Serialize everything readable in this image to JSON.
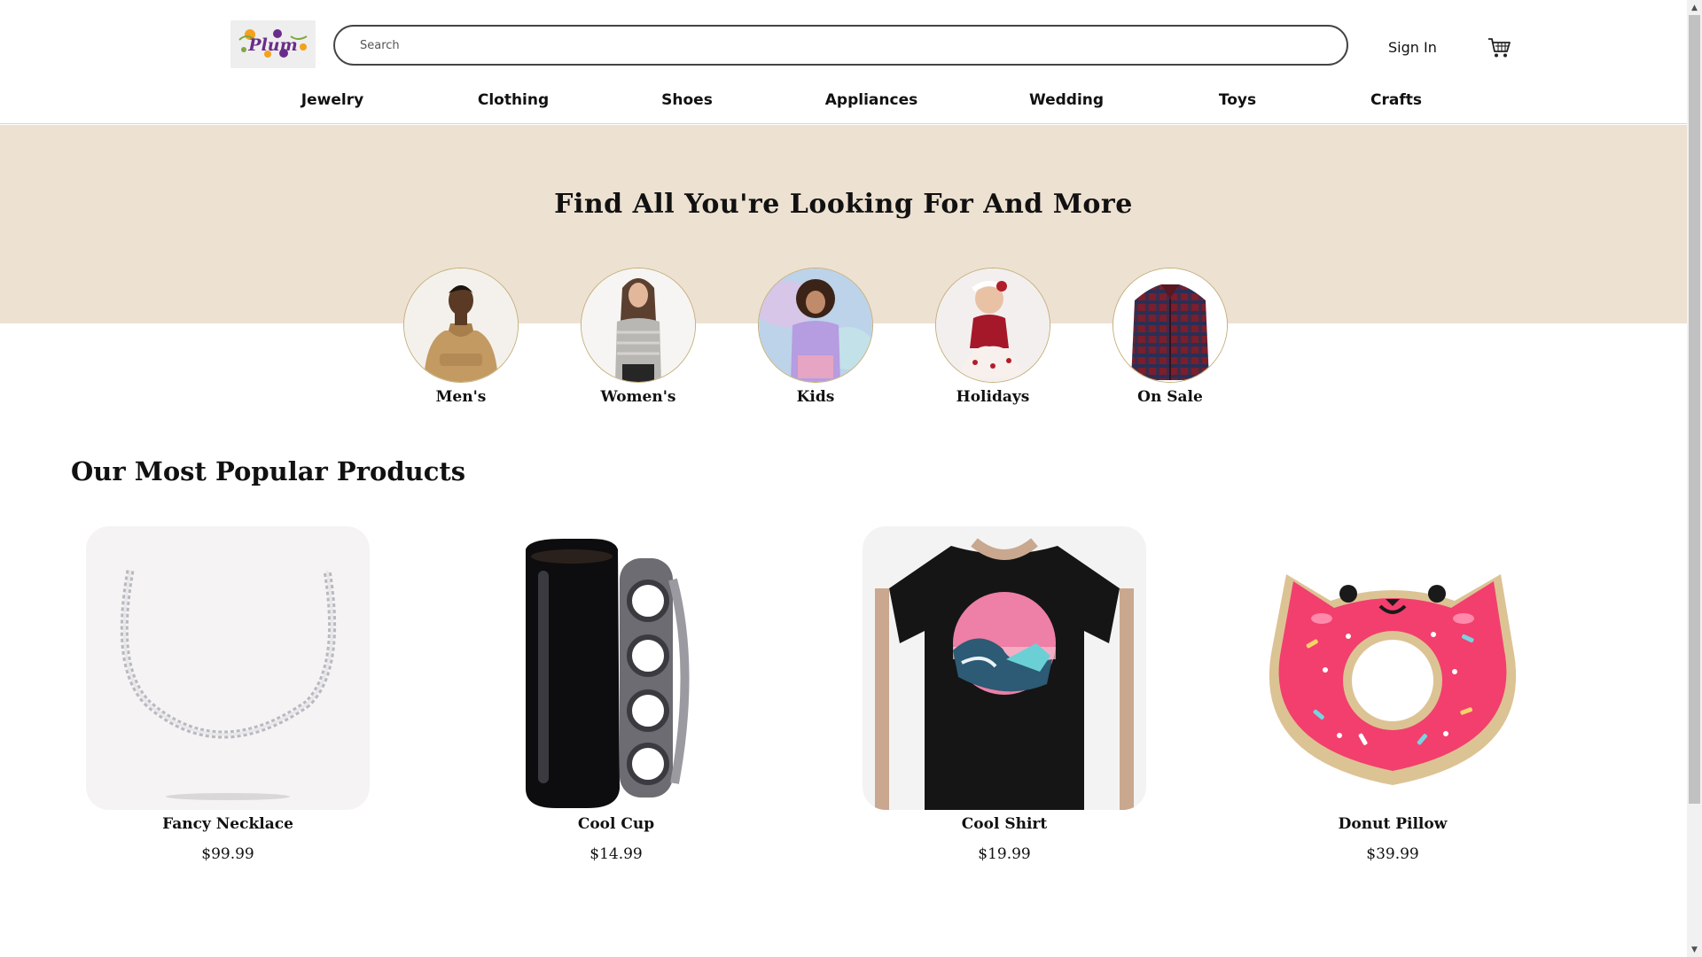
{
  "header": {
    "logo_text": "Plum",
    "search_placeholder": "Search",
    "sign_in": "Sign In",
    "cart_icon": "cart-icon"
  },
  "nav": {
    "items": [
      "Jewelry",
      "Clothing",
      "Shoes",
      "Appliances",
      "Wedding",
      "Toys",
      "Crafts"
    ]
  },
  "hero": {
    "title": "Find All You're Looking For And More",
    "categories": [
      {
        "label": "Men's"
      },
      {
        "label": "Women's"
      },
      {
        "label": "Kids"
      },
      {
        "label": "Holidays"
      },
      {
        "label": "On Sale"
      }
    ]
  },
  "popular": {
    "title": "Our Most Popular Products",
    "products": [
      {
        "name": "Fancy Necklace",
        "price": "$99.99"
      },
      {
        "name": "Cool Cup",
        "price": "$14.99"
      },
      {
        "name": "Cool Shirt",
        "price": "$19.99"
      },
      {
        "name": "Donut Pillow",
        "price": "$39.99"
      }
    ]
  },
  "colors": {
    "hero_background": "#ede1d2",
    "circle_border": "#c4b07c",
    "logo_purple": "#6a2c8a",
    "logo_orange": "#f4a21a"
  }
}
